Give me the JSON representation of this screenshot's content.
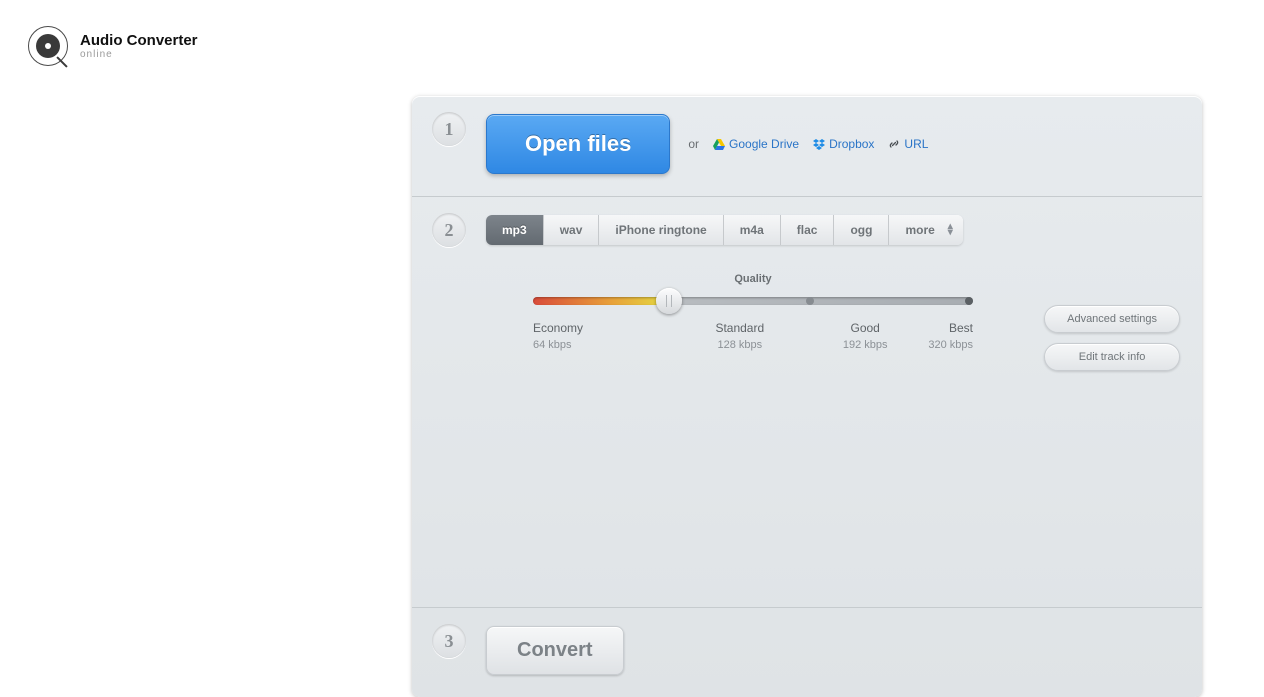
{
  "logo": {
    "title": "Audio Converter",
    "subtitle": "online"
  },
  "steps": {
    "s1": {
      "num": "1"
    },
    "s2": {
      "num": "2"
    },
    "s3": {
      "num": "3"
    }
  },
  "step1": {
    "open_label": "Open files",
    "or_text": "or",
    "gdrive": "Google Drive",
    "dropbox": "Dropbox",
    "url": "URL"
  },
  "formats": {
    "mp3": "mp3",
    "wav": "wav",
    "iphone": "iPhone ringtone",
    "m4a": "m4a",
    "flac": "flac",
    "ogg": "ogg",
    "more": "more"
  },
  "quality": {
    "title": "Quality",
    "economy": {
      "name": "Economy",
      "rate": "64 kbps"
    },
    "standard": {
      "name": "Standard",
      "rate": "128 kbps"
    },
    "good": {
      "name": "Good",
      "rate": "192 kbps"
    },
    "best": {
      "name": "Best",
      "rate": "320 kbps"
    }
  },
  "side_buttons": {
    "advanced": "Advanced settings",
    "edit_track": "Edit track info"
  },
  "convert": {
    "label": "Convert"
  }
}
